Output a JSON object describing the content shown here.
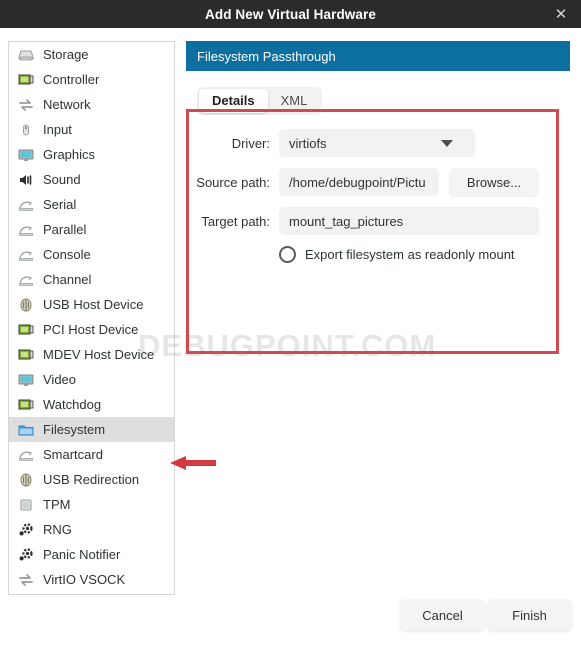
{
  "window": {
    "title": "Add New Virtual Hardware",
    "close_icon": "close-icon"
  },
  "sidebar": {
    "items": [
      {
        "label": "Storage",
        "icon": "hard-drive-icon"
      },
      {
        "label": "Controller",
        "icon": "pci-card-icon"
      },
      {
        "label": "Network",
        "icon": "network-arrows-icon"
      },
      {
        "label": "Input",
        "icon": "mouse-icon"
      },
      {
        "label": "Graphics",
        "icon": "monitor-icon"
      },
      {
        "label": "Sound",
        "icon": "speaker-icon"
      },
      {
        "label": "Serial",
        "icon": "serial-port-icon"
      },
      {
        "label": "Parallel",
        "icon": "serial-port-icon"
      },
      {
        "label": "Console",
        "icon": "serial-port-icon"
      },
      {
        "label": "Channel",
        "icon": "serial-port-icon"
      },
      {
        "label": "USB Host Device",
        "icon": "usb-icon"
      },
      {
        "label": "PCI Host Device",
        "icon": "pci-card-icon"
      },
      {
        "label": "MDEV Host Device",
        "icon": "pci-card-icon"
      },
      {
        "label": "Video",
        "icon": "monitor-icon"
      },
      {
        "label": "Watchdog",
        "icon": "pci-card-icon"
      },
      {
        "label": "Filesystem",
        "icon": "folder-icon",
        "selected": true
      },
      {
        "label": "Smartcard",
        "icon": "serial-port-icon"
      },
      {
        "label": "USB Redirection",
        "icon": "usb-icon"
      },
      {
        "label": "TPM",
        "icon": "chip-icon"
      },
      {
        "label": "RNG",
        "icon": "gear-icon"
      },
      {
        "label": "Panic Notifier",
        "icon": "gear-icon"
      },
      {
        "label": "VirtIO VSOCK",
        "icon": "network-arrows-icon"
      }
    ]
  },
  "pane": {
    "header_title": "Filesystem Passthrough",
    "tabs": [
      {
        "label": "Details",
        "active": true
      },
      {
        "label": "XML",
        "active": false
      }
    ],
    "form": {
      "driver_label": "Driver:",
      "driver_value": "virtiofs",
      "source_label": "Source path:",
      "source_value": "/home/debugpoint/Pictu",
      "source_placeholder": "",
      "browse_label": "Browse...",
      "target_label": "Target path:",
      "target_value": "mount_tag_pictures",
      "target_placeholder": "",
      "readonly_label": "Export filesystem as readonly mount",
      "readonly_checked": false
    }
  },
  "annotations": {
    "watermark": "DEBUGPOINT.COM",
    "box_color": "#cf4b52",
    "arrow_color": "#d33a3f"
  },
  "footer": {
    "cancel_label": "Cancel",
    "finish_label": "Finish"
  }
}
